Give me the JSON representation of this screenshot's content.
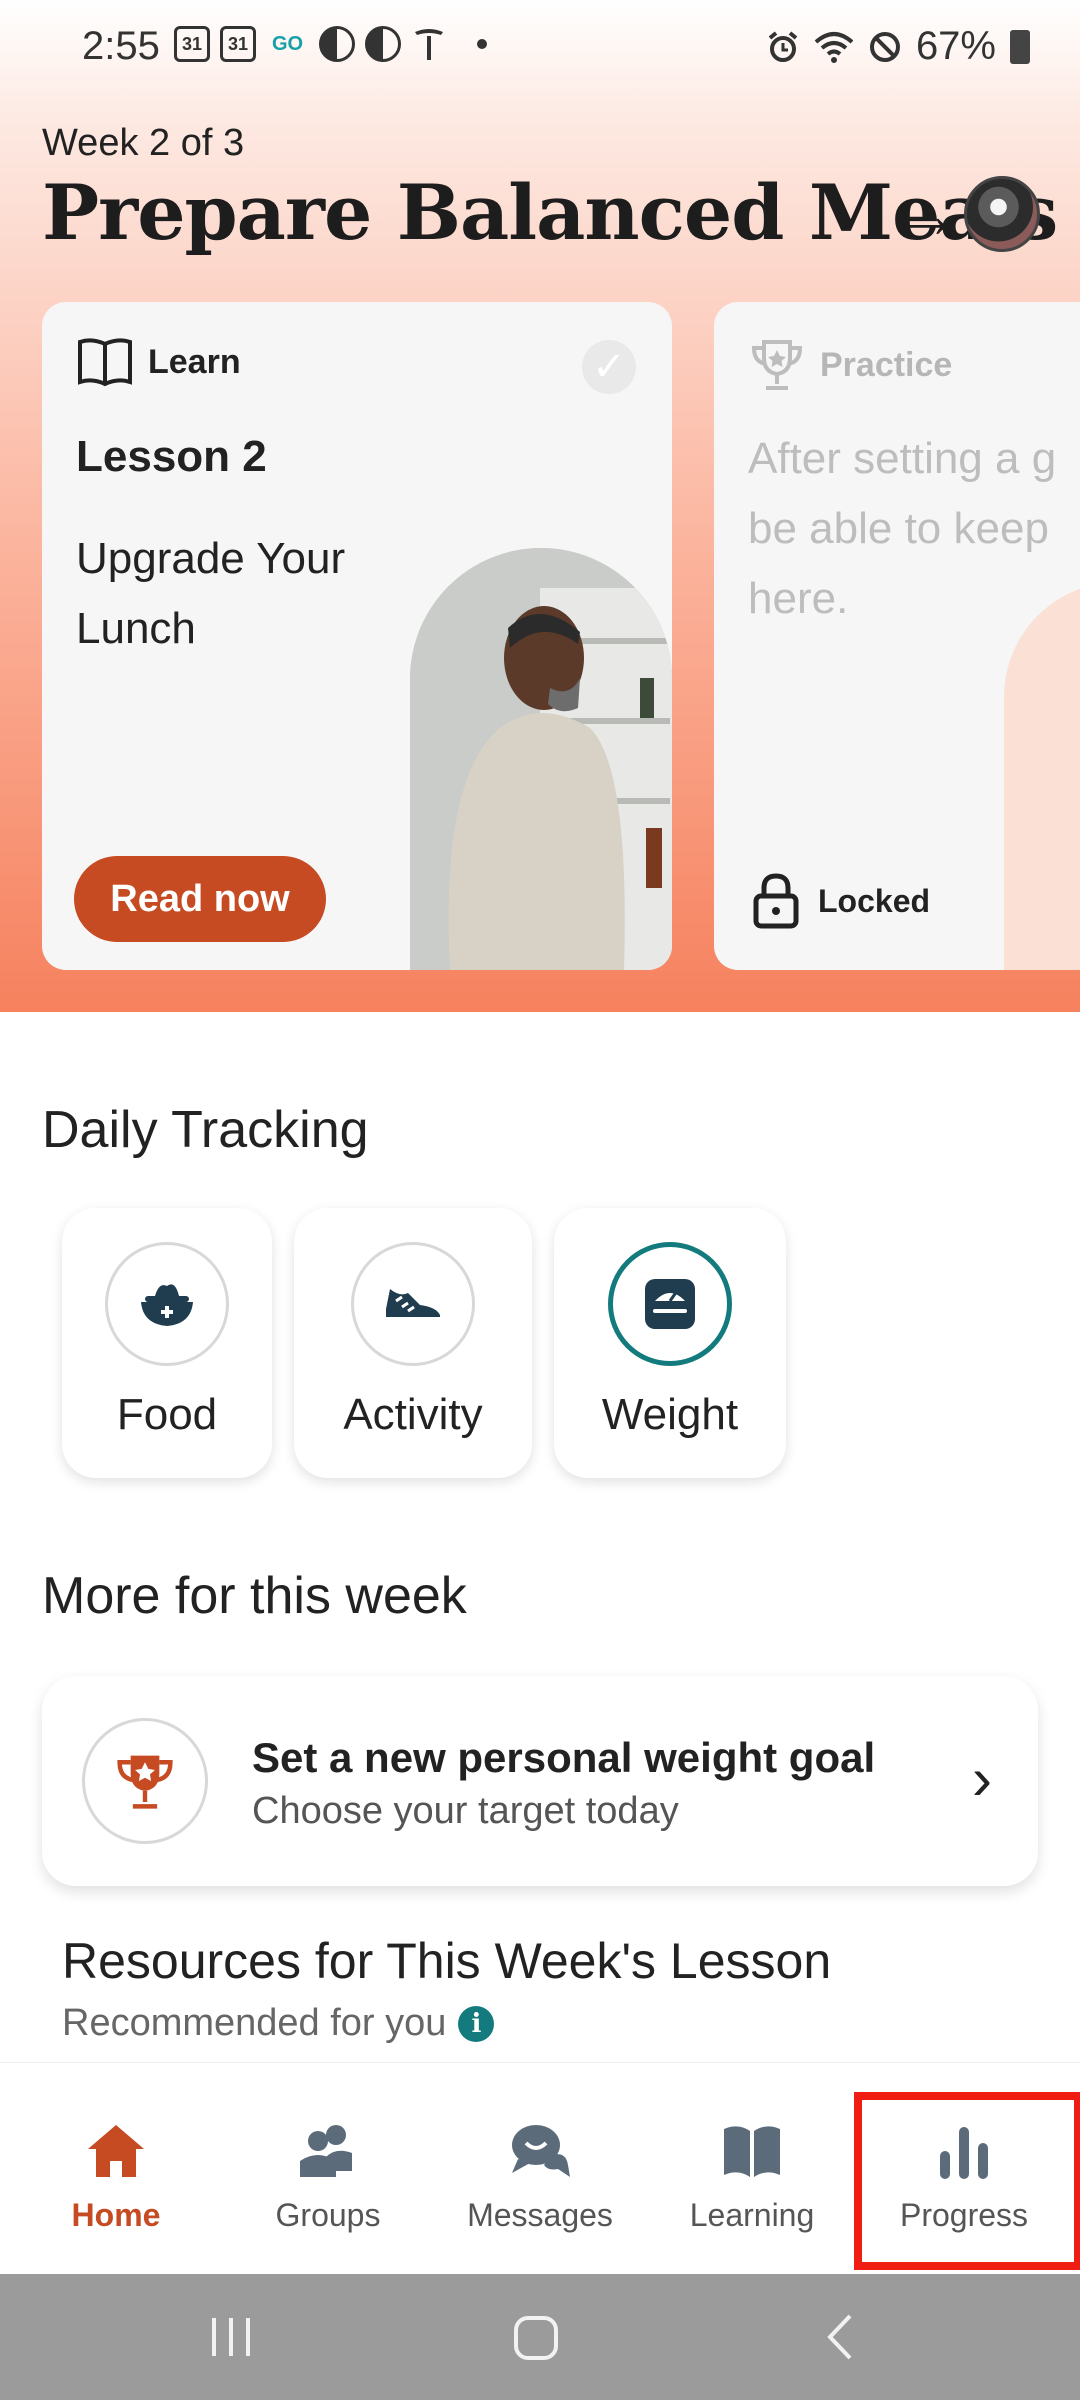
{
  "status_bar": {
    "time": "2:55",
    "calendar_a": "31",
    "calendar_b": "31",
    "go_badge": "GO",
    "battery": "67%"
  },
  "header": {
    "week_label": "Week 2 of 3",
    "title": "Prepare Balanced Meals",
    "arrow": "→"
  },
  "learn_card": {
    "tag": "Learn",
    "lesson_number": "Lesson 2",
    "lesson_title": "Upgrade Your Lunch",
    "button_label": "Read now",
    "completed": true
  },
  "practice_card": {
    "tag": "Practice",
    "text_line1": "After setting a g",
    "text_line2": "be able to keep",
    "text_line3": "here.",
    "status": "Locked"
  },
  "daily_tracking": {
    "title": "Daily Tracking",
    "items": [
      {
        "label": "Food",
        "icon": "food-bowl-icon"
      },
      {
        "label": "Activity",
        "icon": "sneaker-icon"
      },
      {
        "label": "Weight",
        "icon": "scale-icon"
      }
    ]
  },
  "more_week": {
    "title": "More for this week",
    "goal_title": "Set a new personal weight goal",
    "goal_sub": "Choose your target today",
    "chevron": "›"
  },
  "resources": {
    "title": "Resources for This Week's Lesson",
    "subtitle": "Recommended for you",
    "info": "i"
  },
  "bottom_nav": {
    "items": [
      {
        "label": "Home",
        "icon": "home-icon",
        "active": true
      },
      {
        "label": "Groups",
        "icon": "groups-icon",
        "active": false
      },
      {
        "label": "Messages",
        "icon": "messages-icon",
        "active": false
      },
      {
        "label": "Learning",
        "icon": "book-icon",
        "active": false
      },
      {
        "label": "Progress",
        "icon": "bar-chart-icon",
        "active": false
      }
    ]
  },
  "colors": {
    "accent": "#c64a22",
    "teal": "#137b7d",
    "highlight": "#f01e12"
  }
}
